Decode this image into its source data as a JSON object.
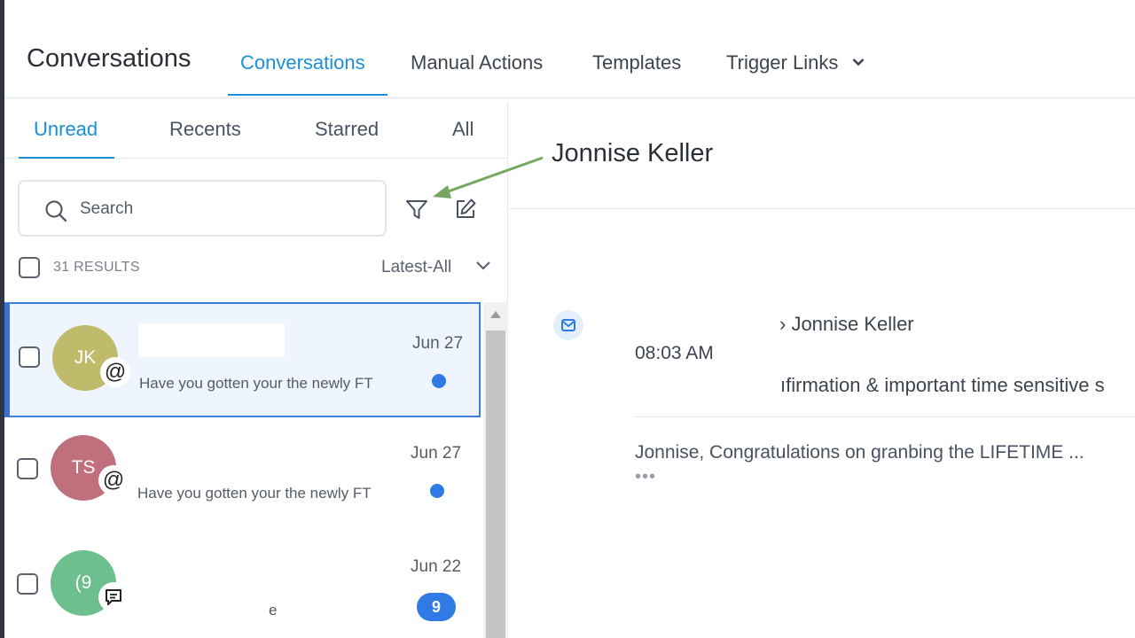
{
  "header": {
    "title": "Conversations",
    "tabs": [
      {
        "label": "Conversations",
        "active": true
      },
      {
        "label": "Manual Actions"
      },
      {
        "label": "Templates"
      },
      {
        "label": "Trigger Links"
      }
    ]
  },
  "sidebar": {
    "tabs": [
      {
        "label": "Unread",
        "active": true
      },
      {
        "label": "Recents"
      },
      {
        "label": "Starred"
      },
      {
        "label": "All"
      }
    ],
    "search": {
      "placeholder": "Search",
      "value": ""
    },
    "results_label": "31 RESULTS",
    "sort_label": "Latest-All",
    "conversations": [
      {
        "initials": "JK",
        "avatar_color": "#bfbb6b",
        "channel_icon": "at-sign-icon",
        "preview": "Have you gotten your the newly FT",
        "date": "Jun 27",
        "unread": "dot",
        "selected": true
      },
      {
        "initials": "TS",
        "avatar_color": "#c0707c",
        "channel_icon": "at-sign-icon",
        "preview": "Have you gotten your the newly FT",
        "date": "Jun 27",
        "unread": "dot"
      },
      {
        "initials": "(9",
        "avatar_color": "#6dbf8e",
        "channel_icon": "chat-bubble-icon",
        "preview": "e",
        "date": "Jun 22",
        "unread_count": "9"
      }
    ]
  },
  "detail": {
    "contact_name": "Jonnise Keller",
    "message": {
      "channel_icon": "email-icon",
      "to": "› Jonnise Keller",
      "time": "08:03 AM",
      "subject": "ıfirmation & important time sensitive s",
      "body": "Jonnise, Congratulations on granbing the LIFETIME ...",
      "more": "•••"
    }
  },
  "colors": {
    "accent": "#1a8fd8",
    "unread": "#2f7ae5",
    "annotation_arrow": "#78a860"
  }
}
